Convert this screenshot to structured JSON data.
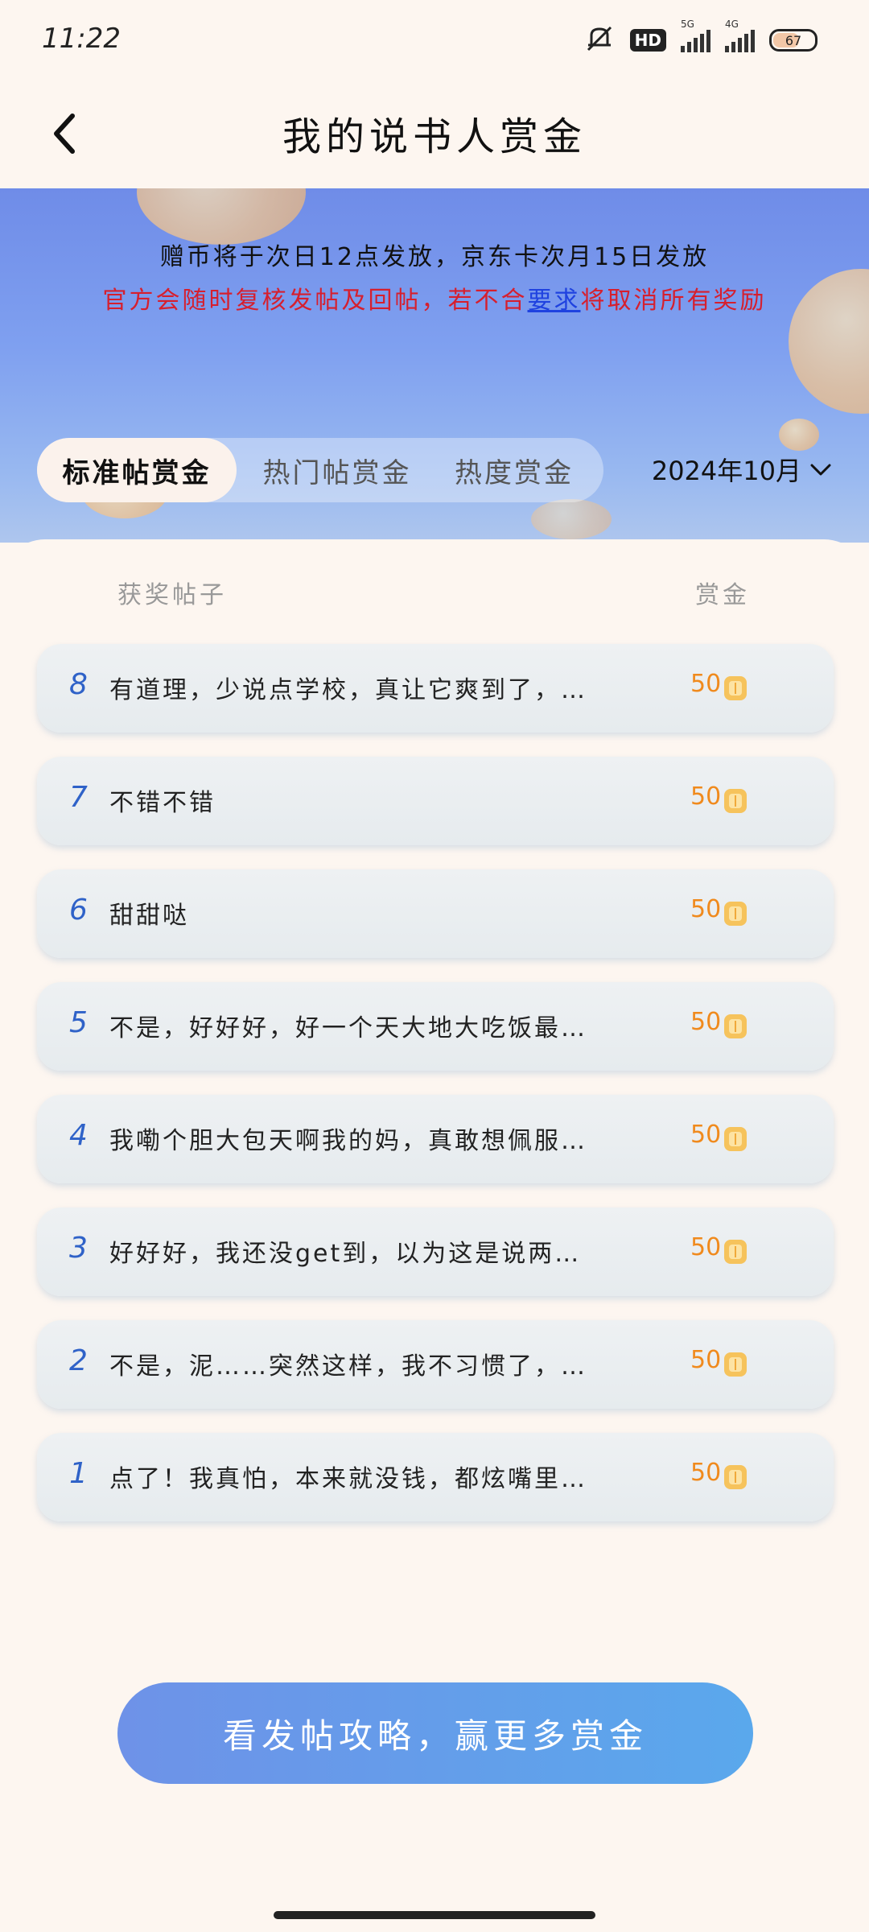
{
  "status_bar": {
    "time": "11:22",
    "hd_label": "HD",
    "signal1_label": "5G",
    "signal2_label": "4G",
    "battery": "67"
  },
  "header": {
    "title": "我的说书人赏金"
  },
  "notices": {
    "line1": "赠币将于次日12点发放，京东卡次月15日发放",
    "line2_before": "官方会随时复核发帖及回帖，若不合",
    "line2_link": "要求",
    "line2_after": "将取消所有奖励"
  },
  "tabs": [
    {
      "label": "标准帖赏金",
      "active": true
    },
    {
      "label": "热门帖赏金",
      "active": false
    },
    {
      "label": "热度赏金",
      "active": false
    }
  ],
  "month_select": {
    "value": "2024年10月"
  },
  "list": {
    "col_post": "获奖帖子",
    "col_reward": "赏金",
    "rows": [
      {
        "rank": "8",
        "post": "有道理，少说点学校，真让它爽到了，…",
        "amount": "50"
      },
      {
        "rank": "7",
        "post": "不错不错",
        "amount": "50"
      },
      {
        "rank": "6",
        "post": "甜甜哒",
        "amount": "50"
      },
      {
        "rank": "5",
        "post": "不是，好好好，好一个天大地大吃饭最…",
        "amount": "50"
      },
      {
        "rank": "4",
        "post": "我嘞个胆大包天啊我的妈，真敢想佩服…",
        "amount": "50"
      },
      {
        "rank": "3",
        "post": "好好好，我还没get到，以为这是说两…",
        "amount": "50"
      },
      {
        "rank": "2",
        "post": "不是，泥……突然这样，我不习惯了，…",
        "amount": "50"
      },
      {
        "rank": "1",
        "post": "点了！我真怕，本来就没钱，都炫嘴里…",
        "amount": "50"
      }
    ]
  },
  "cta": {
    "label": "看发帖攻略，赢更多赏金"
  },
  "colors": {
    "accent_orange": "#f08a1d",
    "rank_blue": "#2f62c8",
    "warning_red": "#d61f2e",
    "link_blue": "#1f42e0",
    "cta_start": "#6e92e8",
    "cta_end": "#5aa8ec"
  },
  "icons": [
    "mute-icon",
    "hd-icon",
    "signal-icon",
    "battery-icon",
    "back-icon",
    "chevron-down-icon",
    "coin-icon"
  ]
}
